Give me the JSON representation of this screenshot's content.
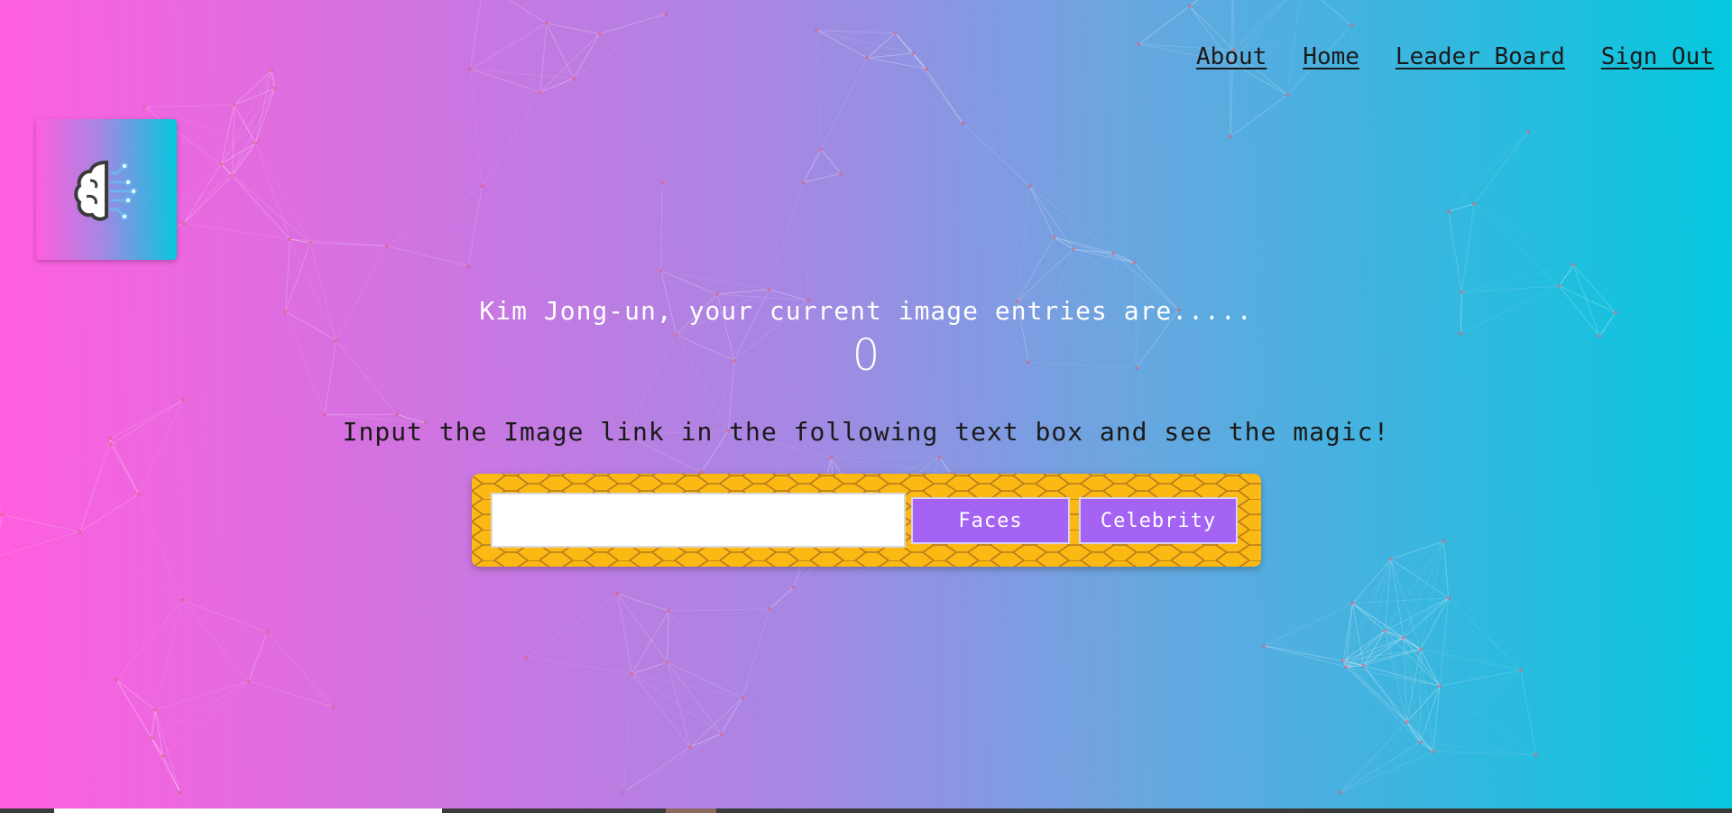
{
  "nav": {
    "links": [
      {
        "label": "About"
      },
      {
        "label": "Home"
      },
      {
        "label": "Leader Board"
      },
      {
        "label": "Sign Out"
      }
    ]
  },
  "logo": {
    "icon": "brain-circuit-icon"
  },
  "entries": {
    "message": "Kim Jong-un, your current image entries are.....",
    "count": "0"
  },
  "instruction": "Input the Image link in the following text box and see the magic!",
  "form": {
    "input_value": "",
    "input_placeholder": "",
    "faces_label": "Faces",
    "celebrity_label": "Celebrity"
  },
  "colors": {
    "gradient_start": "#ff5edf",
    "gradient_end": "#04c8de",
    "panel": "#fcb813",
    "button": "#a463f2"
  }
}
